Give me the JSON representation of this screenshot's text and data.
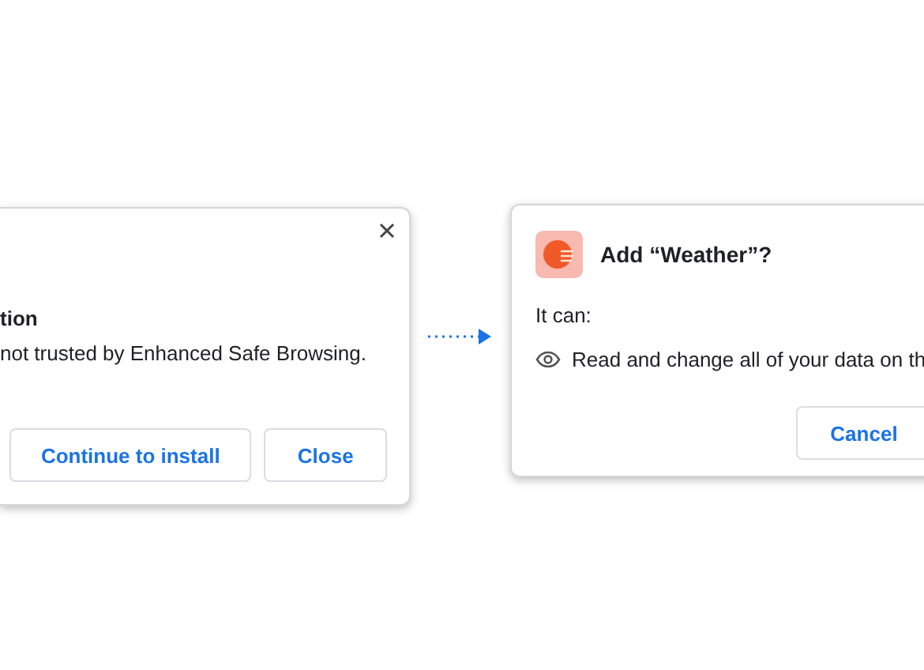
{
  "warning_dialog": {
    "heading": "tion",
    "message": "not trusted by Enhanced Safe Browsing.",
    "buttons": [
      {
        "label": "Continue to install"
      },
      {
        "label": "Close"
      }
    ]
  },
  "install_dialog": {
    "title": "Add “Weather”?",
    "subtitle": "It can:",
    "permissions": [
      "Read and change all of your data on th"
    ],
    "buttons": [
      {
        "label": "Cancel"
      }
    ]
  }
}
